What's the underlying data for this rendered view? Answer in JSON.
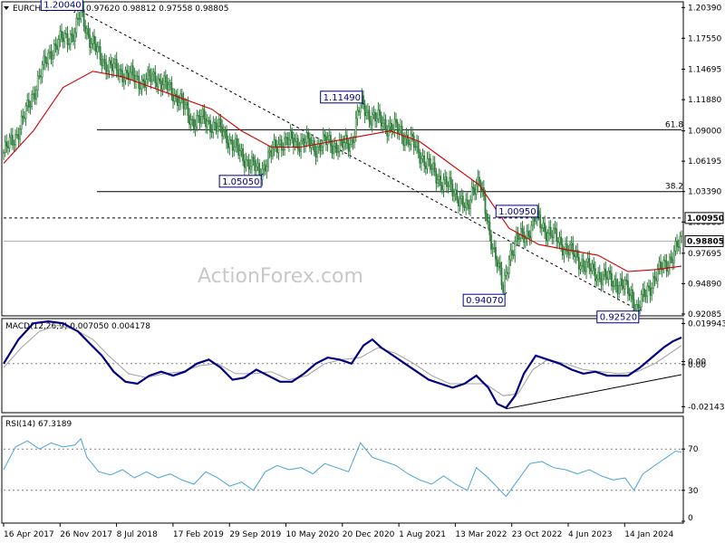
{
  "colors": {
    "candle": "#2e7d3a",
    "ma": "#d00000",
    "macd": "#000080",
    "signal": "#a0a0a0",
    "rsi": "#4aa3d8",
    "label": "#000080"
  },
  "watermark": "ActionForex.com",
  "chart_data": [
    {
      "type": "candlestick",
      "title": "EURCHF,Weekly  0.97620 0.98812 0.97558 0.98805",
      "symbol": "EURCHF,Weekly",
      "ohlc_header": "0.97620 0.98812 0.97558 0.98805",
      "ylim": [
        0.9208,
        1.2075
      ],
      "y_ticks": [
        "1.20390",
        "1.17550",
        "1.14695",
        "1.11880",
        "1.09000",
        "1.06195",
        "1.03390",
        "1.00580",
        "0.97695",
        "0.94890",
        "0.92085"
      ],
      "y_tick_values": [
        1.2039,
        1.1755,
        1.14695,
        1.1188,
        1.09,
        1.06195,
        1.0339,
        1.0058,
        0.97695,
        0.9489,
        0.92085
      ],
      "x_labels": [
        "16 Apr 2017",
        "26 Nov 2017",
        "8 Jul 2018",
        "17 Feb 2019",
        "29 Sep 2019",
        "10 May 2020",
        "20 Dec 2020",
        "1 Aug 2021",
        "13 Mar 2022",
        "23 Oct 2022",
        "4 Jun 2023",
        "14 Jan 2024"
      ],
      "price_path": [
        [
          0,
          1.07
        ],
        [
          8,
          1.085
        ],
        [
          16,
          1.11
        ],
        [
          24,
          1.14
        ],
        [
          32,
          1.165
        ],
        [
          40,
          1.175
        ],
        [
          48,
          1.18
        ],
        [
          52,
          1.2004
        ],
        [
          58,
          1.175
        ],
        [
          64,
          1.16
        ],
        [
          70,
          1.15
        ],
        [
          78,
          1.145
        ],
        [
          86,
          1.14
        ],
        [
          94,
          1.135
        ],
        [
          102,
          1.14
        ],
        [
          110,
          1.13
        ],
        [
          118,
          1.12
        ],
        [
          126,
          1.1
        ],
        [
          134,
          1.1
        ],
        [
          142,
          1.095
        ],
        [
          150,
          1.085
        ],
        [
          158,
          1.07
        ],
        [
          166,
          1.06
        ],
        [
          172,
          1.0505
        ],
        [
          178,
          1.065
        ],
        [
          186,
          1.08
        ],
        [
          194,
          1.08
        ],
        [
          202,
          1.08
        ],
        [
          210,
          1.075
        ],
        [
          218,
          1.08
        ],
        [
          226,
          1.075
        ],
        [
          234,
          1.08
        ],
        [
          240,
          1.1149
        ],
        [
          246,
          1.105
        ],
        [
          252,
          1.1
        ],
        [
          258,
          1.095
        ],
        [
          266,
          1.09
        ],
        [
          274,
          1.08
        ],
        [
          282,
          1.065
        ],
        [
          290,
          1.05
        ],
        [
          298,
          1.04
        ],
        [
          306,
          1.03
        ],
        [
          312,
          1.015
        ],
        [
          316,
          1.04
        ],
        [
          320,
          1.045
        ],
        [
          326,
          1.0
        ],
        [
          332,
          0.97
        ],
        [
          336,
          0.9407
        ],
        [
          340,
          0.975
        ],
        [
          346,
          0.99
        ],
        [
          352,
          0.995
        ],
        [
          358,
          1.0095
        ],
        [
          364,
          1.0
        ],
        [
          372,
          0.99
        ],
        [
          380,
          0.98
        ],
        [
          388,
          0.97
        ],
        [
          396,
          0.96
        ],
        [
          404,
          0.955
        ],
        [
          412,
          0.95
        ],
        [
          418,
          0.945
        ],
        [
          422,
          0.94
        ],
        [
          426,
          0.9252
        ],
        [
          432,
          0.94
        ],
        [
          438,
          0.955
        ],
        [
          444,
          0.965
        ],
        [
          450,
          0.975
        ],
        [
          456,
          0.9881
        ]
      ],
      "ma_path": [
        [
          0,
          1.06
        ],
        [
          20,
          1.09
        ],
        [
          40,
          1.13
        ],
        [
          60,
          1.145
        ],
        [
          80,
          1.14
        ],
        [
          100,
          1.13
        ],
        [
          120,
          1.12
        ],
        [
          140,
          1.11
        ],
        [
          160,
          1.09
        ],
        [
          180,
          1.075
        ],
        [
          200,
          1.075
        ],
        [
          220,
          1.08
        ],
        [
          240,
          1.085
        ],
        [
          260,
          1.09
        ],
        [
          280,
          1.08
        ],
        [
          300,
          1.06
        ],
        [
          320,
          1.04
        ],
        [
          340,
          1.0
        ],
        [
          360,
          0.985
        ],
        [
          380,
          0.98
        ],
        [
          400,
          0.975
        ],
        [
          420,
          0.96
        ],
        [
          440,
          0.962
        ],
        [
          456,
          0.965
        ]
      ],
      "levels": [
        {
          "label": "61.8",
          "value": 1.091,
          "style": "solid"
        },
        {
          "label": "38.2",
          "value": 1.0339,
          "style": "solid"
        },
        {
          "label": "1.00950",
          "value": 1.0095,
          "style": "dotted"
        },
        {
          "label": "0.98805",
          "value": 0.98805,
          "style": "solid-gray"
        }
      ],
      "trendline": {
        "from": [
          52,
          1.2004
        ],
        "to": [
          426,
          0.9252
        ]
      },
      "annotations": [
        {
          "text": "1.20040",
          "x": 52,
          "y": 1.2004
        },
        {
          "text": "1.05050",
          "x": 172,
          "y": 1.0505
        },
        {
          "text": "1.11490",
          "x": 240,
          "y": 1.1149
        },
        {
          "text": "1.00950",
          "x": 358,
          "y": 1.0095
        },
        {
          "text": "0.94070",
          "x": 336,
          "y": 0.9407
        },
        {
          "text": "0.92520",
          "x": 426,
          "y": 0.9252
        }
      ],
      "price_labels": [
        "1.00950",
        "0.98805"
      ]
    },
    {
      "type": "line",
      "title": "MACD(12,26,9) 0.007050 0.004178",
      "ylim": [
        -0.0235,
        0.0215
      ],
      "y_ticks": [
        "0.019943",
        "0.00",
        "0.00",
        "-0.021434"
      ],
      "y_tick_values": [
        0.019943,
        0.001,
        -0.0005,
        -0.021434
      ],
      "series": [
        {
          "name": "MACD",
          "points": [
            [
              0,
              0.0
            ],
            [
              10,
              0.012
            ],
            [
              20,
              0.02
            ],
            [
              30,
              0.021
            ],
            [
              40,
              0.02
            ],
            [
              50,
              0.016
            ],
            [
              58,
              0.01
            ],
            [
              66,
              0.004
            ],
            [
              74,
              -0.004
            ],
            [
              82,
              -0.009
            ],
            [
              90,
              -0.01
            ],
            [
              98,
              -0.006
            ],
            [
              106,
              -0.004
            ],
            [
              114,
              -0.006
            ],
            [
              122,
              -0.004
            ],
            [
              130,
              0.0
            ],
            [
              138,
              0.002
            ],
            [
              146,
              -0.002
            ],
            [
              154,
              -0.008
            ],
            [
              162,
              -0.007
            ],
            [
              170,
              -0.003
            ],
            [
              178,
              -0.006
            ],
            [
              186,
              -0.009
            ],
            [
              194,
              -0.009
            ],
            [
              202,
              -0.005
            ],
            [
              210,
              0.0
            ],
            [
              218,
              0.003
            ],
            [
              226,
              0.002
            ],
            [
              234,
              0.0
            ],
            [
              242,
              0.009
            ],
            [
              248,
              0.012
            ],
            [
              254,
              0.008
            ],
            [
              262,
              0.004
            ],
            [
              270,
              0.0
            ],
            [
              278,
              -0.004
            ],
            [
              286,
              -0.008
            ],
            [
              294,
              -0.01
            ],
            [
              302,
              -0.012
            ],
            [
              310,
              -0.01
            ],
            [
              318,
              -0.006
            ],
            [
              326,
              -0.012
            ],
            [
              332,
              -0.02
            ],
            [
              338,
              -0.022
            ],
            [
              344,
              -0.016
            ],
            [
              350,
              -0.005
            ],
            [
              358,
              0.004
            ],
            [
              366,
              0.002
            ],
            [
              374,
              0.0
            ],
            [
              382,
              -0.003
            ],
            [
              390,
              -0.005
            ],
            [
              398,
              -0.004
            ],
            [
              406,
              -0.006
            ],
            [
              414,
              -0.006
            ],
            [
              420,
              -0.006
            ],
            [
              428,
              -0.002
            ],
            [
              436,
              0.003
            ],
            [
              444,
              0.008
            ],
            [
              450,
              0.011
            ],
            [
              456,
              0.013
            ]
          ]
        },
        {
          "name": "Signal",
          "points": [
            [
              0,
              -0.002
            ],
            [
              12,
              0.008
            ],
            [
              24,
              0.016
            ],
            [
              36,
              0.019
            ],
            [
              48,
              0.017
            ],
            [
              60,
              0.012
            ],
            [
              72,
              0.003
            ],
            [
              84,
              -0.005
            ],
            [
              96,
              -0.007
            ],
            [
              108,
              -0.005
            ],
            [
              120,
              -0.004
            ],
            [
              132,
              -0.001
            ],
            [
              144,
              0.0
            ],
            [
              156,
              -0.005
            ],
            [
              168,
              -0.005
            ],
            [
              180,
              -0.004
            ],
            [
              192,
              -0.008
            ],
            [
              204,
              -0.006
            ],
            [
              216,
              0.0
            ],
            [
              228,
              0.002
            ],
            [
              240,
              0.003
            ],
            [
              252,
              0.008
            ],
            [
              264,
              0.005
            ],
            [
              276,
              0.0
            ],
            [
              288,
              -0.006
            ],
            [
              300,
              -0.01
            ],
            [
              312,
              -0.01
            ],
            [
              324,
              -0.01
            ],
            [
              336,
              -0.016
            ],
            [
              346,
              -0.015
            ],
            [
              356,
              -0.003
            ],
            [
              366,
              0.002
            ],
            [
              378,
              0.0
            ],
            [
              390,
              -0.003
            ],
            [
              402,
              -0.004
            ],
            [
              414,
              -0.005
            ],
            [
              426,
              -0.004
            ],
            [
              438,
              0.0
            ],
            [
              448,
              0.005
            ],
            [
              456,
              0.009
            ]
          ]
        }
      ],
      "trendline": {
        "from": [
          338,
          -0.0225
        ],
        "to": [
          456,
          -0.0055
        ]
      }
    },
    {
      "type": "line",
      "title": "RSI(14) 67.3189",
      "ylim": [
        0,
        100
      ],
      "y_ticks": [
        "70",
        "30",
        "0"
      ],
      "y_tick_values": [
        70,
        30,
        0
      ],
      "levels": [
        70,
        30
      ],
      "series": [
        {
          "name": "RSI",
          "points": [
            [
              0,
              50
            ],
            [
              8,
              72
            ],
            [
              16,
              78
            ],
            [
              24,
              70
            ],
            [
              32,
              76
            ],
            [
              40,
              72
            ],
            [
              48,
              74
            ],
            [
              52,
              80
            ],
            [
              56,
              62
            ],
            [
              64,
              48
            ],
            [
              72,
              45
            ],
            [
              80,
              50
            ],
            [
              88,
              42
            ],
            [
              96,
              48
            ],
            [
              104,
              42
            ],
            [
              112,
              46
            ],
            [
              120,
              40
            ],
            [
              128,
              36
            ],
            [
              136,
              48
            ],
            [
              144,
              42
            ],
            [
              152,
              34
            ],
            [
              160,
              38
            ],
            [
              168,
              30
            ],
            [
              176,
              48
            ],
            [
              184,
              54
            ],
            [
              192,
              50
            ],
            [
              200,
              52
            ],
            [
              208,
              46
            ],
            [
              216,
              56
            ],
            [
              224,
              52
            ],
            [
              232,
              48
            ],
            [
              240,
              76
            ],
            [
              248,
              62
            ],
            [
              256,
              58
            ],
            [
              264,
              54
            ],
            [
              272,
              46
            ],
            [
              280,
              40
            ],
            [
              288,
              36
            ],
            [
              296,
              44
            ],
            [
              304,
              36
            ],
            [
              312,
              30
            ],
            [
              318,
              52
            ],
            [
              326,
              42
            ],
            [
              334,
              30
            ],
            [
              338,
              24
            ],
            [
              346,
              40
            ],
            [
              354,
              56
            ],
            [
              362,
              58
            ],
            [
              370,
              52
            ],
            [
              378,
              50
            ],
            [
              386,
              46
            ],
            [
              394,
              50
            ],
            [
              402,
              44
            ],
            [
              410,
              40
            ],
            [
              418,
              42
            ],
            [
              424,
              30
            ],
            [
              430,
              46
            ],
            [
              438,
              54
            ],
            [
              446,
              62
            ],
            [
              452,
              68
            ],
            [
              456,
              67
            ]
          ]
        }
      ]
    }
  ]
}
